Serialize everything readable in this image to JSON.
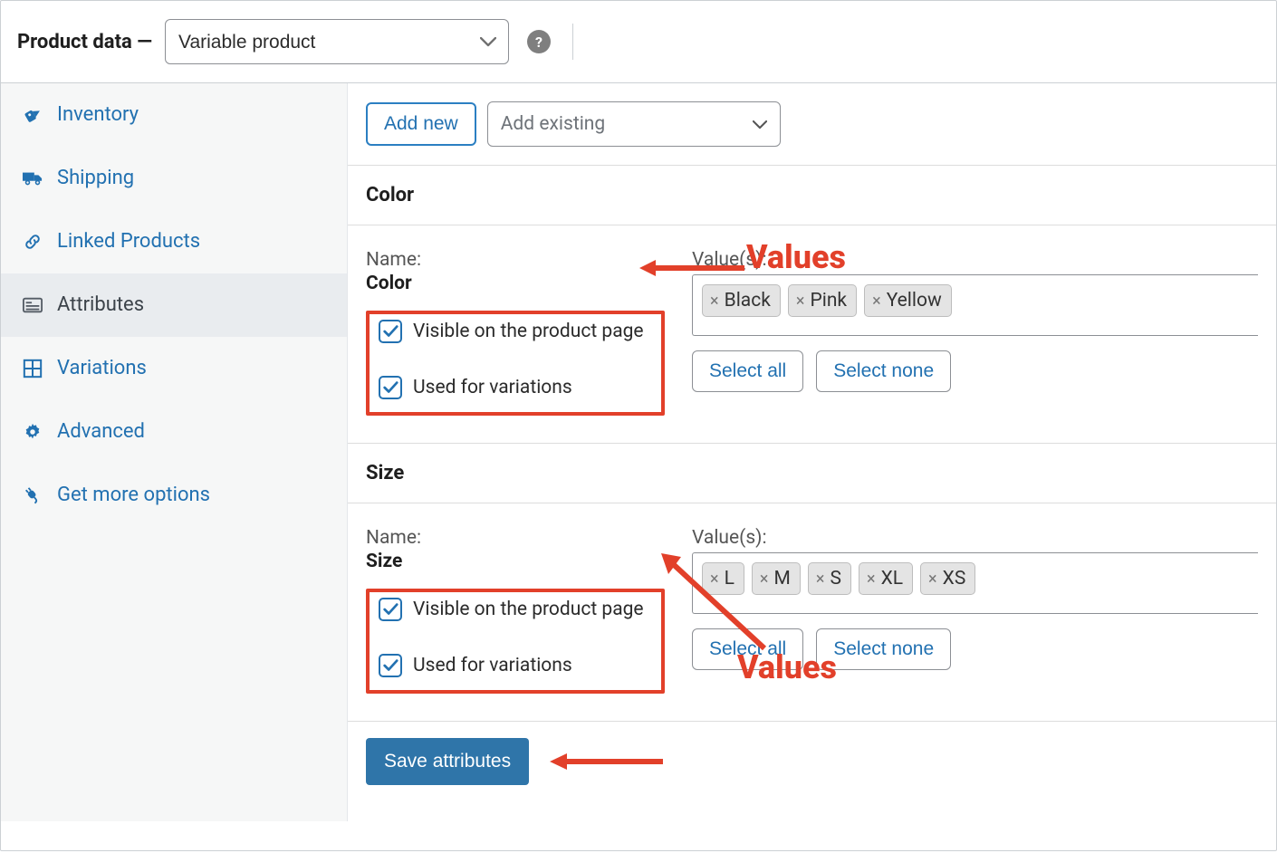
{
  "header": {
    "title": "Product data —",
    "product_type_select": "Variable product",
    "help_tooltip": "?"
  },
  "sidebar": {
    "items": [
      {
        "id": "inventory",
        "label": "Inventory",
        "active": false
      },
      {
        "id": "shipping",
        "label": "Shipping",
        "active": false
      },
      {
        "id": "linked-products",
        "label": "Linked Products",
        "active": false
      },
      {
        "id": "attributes",
        "label": "Attributes",
        "active": true
      },
      {
        "id": "variations",
        "label": "Variations",
        "active": false
      },
      {
        "id": "advanced",
        "label": "Advanced",
        "active": false
      },
      {
        "id": "get-more",
        "label": "Get more options",
        "active": false
      }
    ]
  },
  "toolbar": {
    "add_new_label": "Add new",
    "add_existing_placeholder": "Add existing"
  },
  "labels": {
    "name": "Name:",
    "values": "Value(s):",
    "visible": "Visible on the product page",
    "used_for_variations": "Used for variations",
    "select_all": "Select all",
    "select_none": "Select none",
    "save_attributes": "Save attributes"
  },
  "attributes": [
    {
      "title": "Color",
      "name": "Color",
      "visible": true,
      "used_for_variations": true,
      "values": [
        "Black",
        "Pink",
        "Yellow"
      ]
    },
    {
      "title": "Size",
      "name": "Size",
      "visible": true,
      "used_for_variations": true,
      "values": [
        "L",
        "M",
        "S",
        "XL",
        "XS"
      ]
    }
  ],
  "annotations": {
    "values_label": "Values"
  }
}
